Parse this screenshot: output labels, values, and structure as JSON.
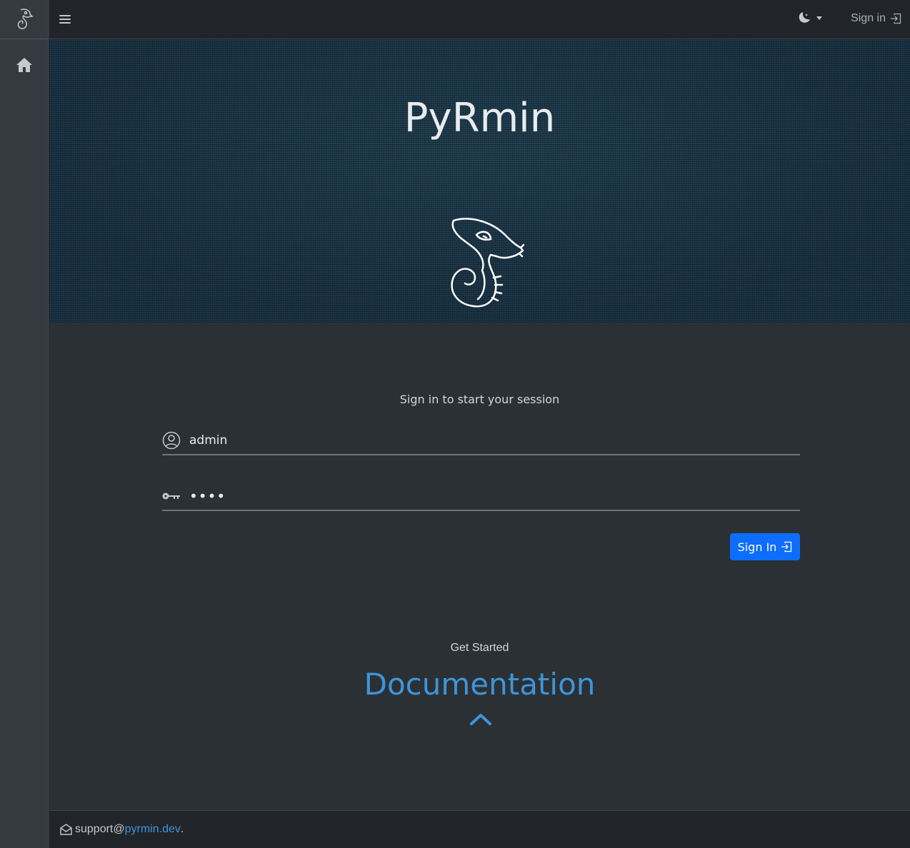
{
  "sidebar": {
    "brand_icon": "pyrmin-snake-logo-icon",
    "items": [
      {
        "icon": "home-icon",
        "label": "Home"
      }
    ]
  },
  "navbar": {
    "menu_icon": "hamburger-menu-icon",
    "theme_icon": "moon-stars-icon",
    "signin_label": "Sign in",
    "signin_icon": "box-arrow-in-right-icon"
  },
  "hero": {
    "title": "PyRmin",
    "logo_icon": "pyrmin-snake-logo-icon"
  },
  "login": {
    "message": "Sign in to start your session",
    "username_value": "admin",
    "username_icon": "person-circle-icon",
    "password_value": "••••",
    "password_icon": "key-icon",
    "submit_label": "Sign In",
    "submit_icon": "box-arrow-in-right-icon"
  },
  "get_started": {
    "label": "Get Started",
    "docs_label": "Documentation",
    "docs_icon": "chevron-up-icon"
  },
  "footer": {
    "prefix": "support@",
    "link": "pyrmin.dev",
    "suffix": ".",
    "icon": "envelope-open-icon"
  },
  "colors": {
    "primary": "#0d6efd",
    "link": "#3d95d8",
    "hero_bg": "#1b3547",
    "content_bg": "#2b3035",
    "sidebar_bg": "#343a40",
    "navbar_bg": "#212529"
  }
}
